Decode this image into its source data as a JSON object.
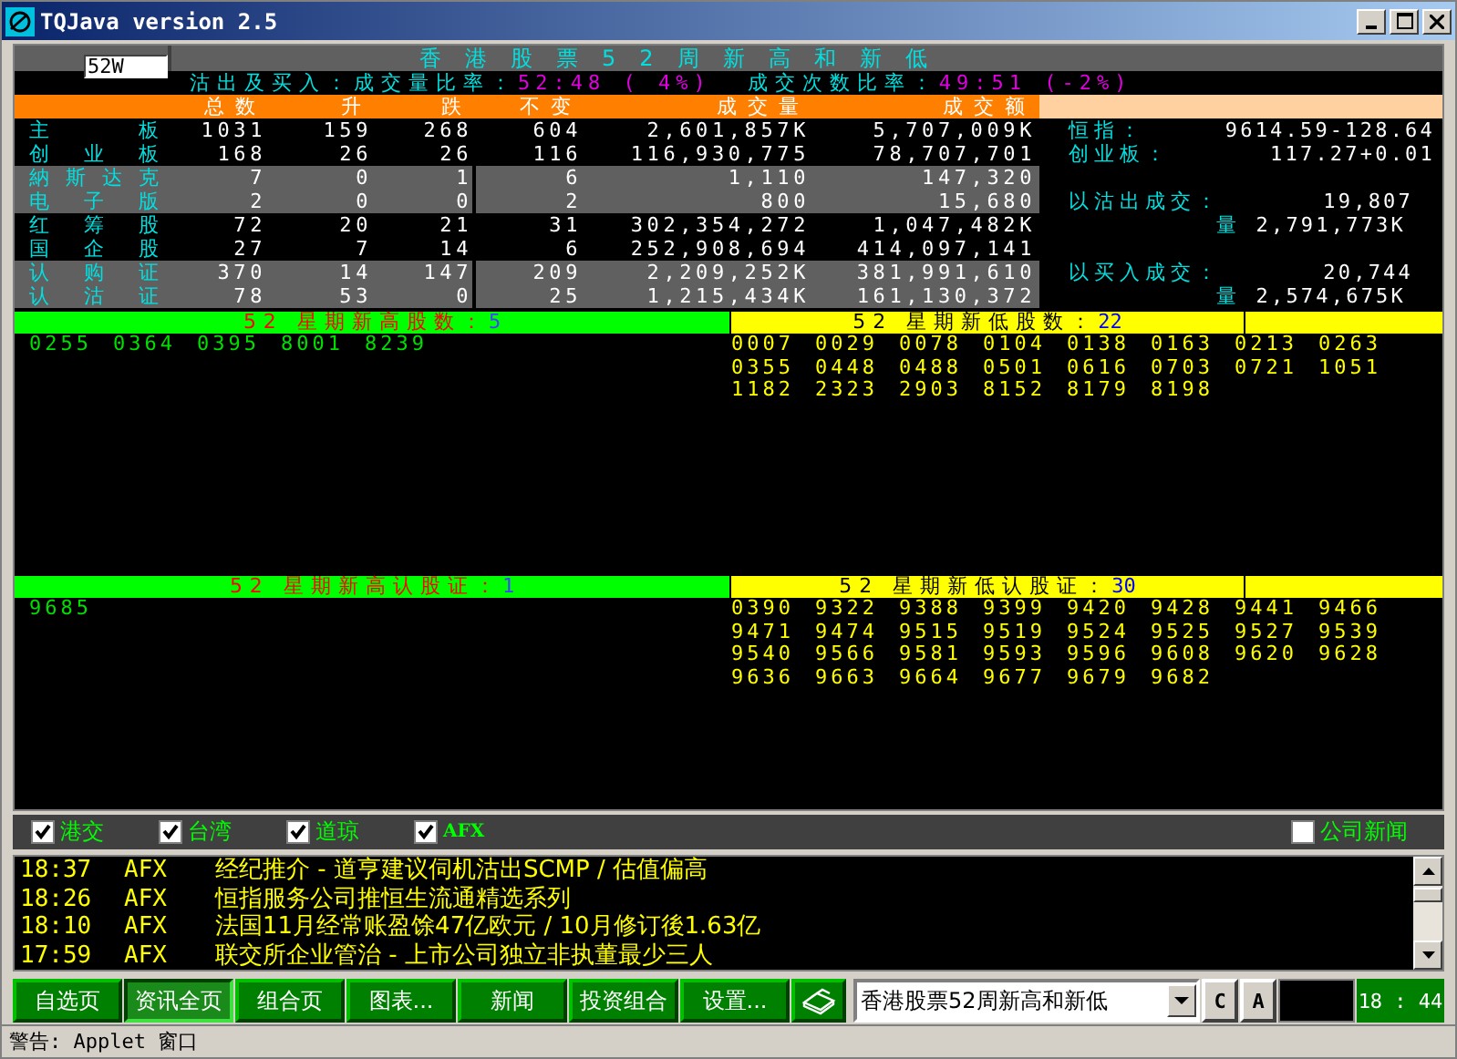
{
  "window": {
    "title": "TQJava version 2.5"
  },
  "code_field": {
    "value": "52W"
  },
  "page_title": "香港股票52周新高和新低",
  "ratio_line": [
    {
      "label": "沽出及买入：成交量比率：",
      "value": "52:48 ( 4%)"
    },
    {
      "label": "成交次数比率：",
      "value": "49:51 (-2%)"
    }
  ],
  "table": {
    "columns": [
      "总数",
      "升",
      "跌",
      "不变",
      "成交量",
      "成交额"
    ],
    "rows": [
      {
        "name": "主板",
        "shaded": false,
        "cells": [
          "1031",
          "159",
          "268",
          "604",
          "2,601,857K",
          "5,707,009K"
        ]
      },
      {
        "name": "创业板",
        "shaded": false,
        "cells": [
          "168",
          "26",
          "26",
          "116",
          "116,930,775",
          "78,707,701"
        ]
      },
      {
        "name": "納斯达克",
        "shaded": true,
        "cells": [
          "7",
          "0",
          "1",
          "6",
          "1,110",
          "147,320"
        ]
      },
      {
        "name": "电子版",
        "shaded": true,
        "cells": [
          "2",
          "0",
          "0",
          "2",
          "800",
          "15,680"
        ]
      },
      {
        "name": "红筹股",
        "shaded": false,
        "cells": [
          "72",
          "20",
          "21",
          "31",
          "302,354,272",
          "1,047,482K"
        ]
      },
      {
        "name": "国企股",
        "shaded": false,
        "cells": [
          "27",
          "7",
          "14",
          "6",
          "252,908,694",
          "414,097,141"
        ]
      },
      {
        "name": "认购证",
        "shaded": true,
        "cells": [
          "370",
          "14",
          "147",
          "209",
          "2,209,252K",
          "381,991,610"
        ]
      },
      {
        "name": "认沽证",
        "shaded": true,
        "cells": [
          "78",
          "53",
          "0",
          "25",
          "1,215,434K",
          "161,130,372"
        ]
      }
    ]
  },
  "index_panel": [
    {
      "kind": "line",
      "label": "恒指：",
      "value": "9614.59-128.64"
    },
    {
      "kind": "line",
      "label": "创业板：",
      "value": "117.27+0.01"
    },
    {
      "kind": "spacer"
    },
    {
      "kind": "line",
      "label": "以沽出成交：",
      "value": "19,807"
    },
    {
      "kind": "sub",
      "label": "量",
      "value": "2,791,773K"
    },
    {
      "kind": "spacer"
    },
    {
      "kind": "line",
      "label": "以买入成交：",
      "value": "20,744"
    },
    {
      "kind": "sub",
      "label": "量",
      "value": "2,574,675K"
    }
  ],
  "sections": [
    {
      "high": {
        "title": "52 星期新高股数：",
        "count": "5",
        "codes": [
          "0255",
          "0364",
          "0395",
          "8001",
          "8239"
        ]
      },
      "low": {
        "title": "52 星期新低股数：",
        "count": "22",
        "codes": [
          "0007",
          "0029",
          "0078",
          "0104",
          "0138",
          "0163",
          "0213",
          "0263",
          "0355",
          "0448",
          "0488",
          "0501",
          "0616",
          "0703",
          "0721",
          "1051",
          "1182",
          "2323",
          "2903",
          "8152",
          "8179",
          "8198"
        ]
      }
    },
    {
      "high": {
        "title": "52 星期新高认股证：",
        "count": "1",
        "codes": [
          "9685"
        ]
      },
      "low": {
        "title": "52 星期新低认股证：",
        "count": "30",
        "codes": [
          "0390",
          "9322",
          "9388",
          "9399",
          "9420",
          "9428",
          "9441",
          "9466",
          "9471",
          "9474",
          "9515",
          "9519",
          "9524",
          "9525",
          "9527",
          "9539",
          "9540",
          "9566",
          "9581",
          "9593",
          "9596",
          "9608",
          "9620",
          "9628",
          "9636",
          "9663",
          "9664",
          "9677",
          "9679",
          "9682"
        ]
      }
    }
  ],
  "news_sources": [
    {
      "label": "港交",
      "checked": true
    },
    {
      "label": "台湾",
      "checked": true
    },
    {
      "label": "道琼",
      "checked": true
    },
    {
      "label": "AFX",
      "checked": true
    },
    {
      "label": "公司新闻",
      "checked": false
    }
  ],
  "news": [
    {
      "time": "18:37",
      "source": "AFX",
      "headline": "经纪推介 - 道亨建议伺机沽出SCMP / 估值偏高"
    },
    {
      "time": "18:26",
      "source": "AFX",
      "headline": "恒指服务公司推恒生流通精选系列"
    },
    {
      "time": "18:10",
      "source": "AFX",
      "headline": "法国11月经常账盈馀47亿欧元 / 10月修订後1.63亿"
    },
    {
      "time": "17:59",
      "source": "AFX",
      "headline": "联交所企业管治 - 上市公司独立非执董最少三人"
    }
  ],
  "toolbar": [
    {
      "label": "自选页",
      "selected": false
    },
    {
      "label": "资讯全页",
      "selected": true
    },
    {
      "label": "组合页",
      "selected": false
    },
    {
      "label": "图表...",
      "selected": false
    },
    {
      "label": "新闻",
      "selected": false
    },
    {
      "label": "投资组合",
      "selected": false
    },
    {
      "label": "设置...",
      "selected": false
    }
  ],
  "page_select": {
    "value": "香港股票52周新高和新低"
  },
  "small_buttons": [
    "C",
    "A"
  ],
  "clock": "18 : 44",
  "status_bar": "警告: Applet 窗口"
}
